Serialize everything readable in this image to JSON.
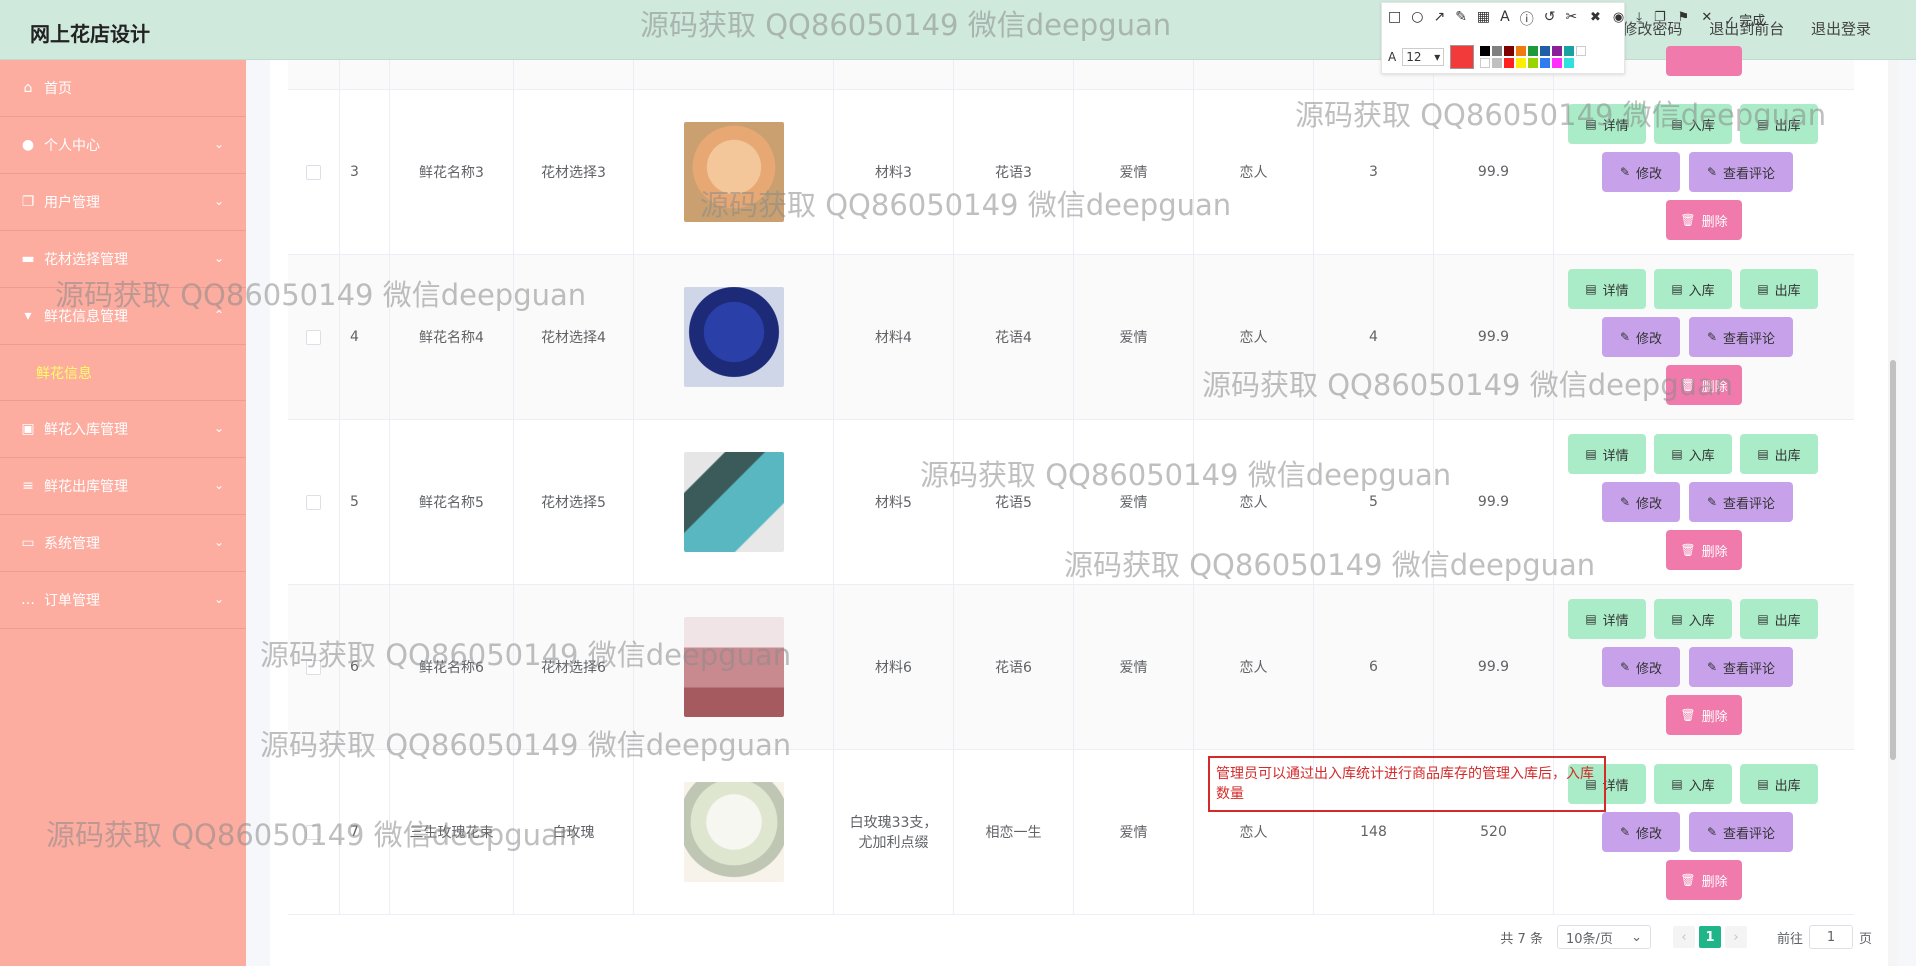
{
  "app": {
    "title": "网上花店设计",
    "header_links": [
      "修改密码",
      "退出到前台",
      "退出登录"
    ]
  },
  "sidebar": {
    "items": [
      {
        "label": "首页",
        "icon": "home-icon"
      },
      {
        "label": "个人中心",
        "icon": "user-icon"
      },
      {
        "label": "用户管理",
        "icon": "copy-icon"
      },
      {
        "label": "花材选择管理",
        "icon": "chat-icon"
      },
      {
        "label": "鲜花信息管理",
        "icon": "drink-icon"
      },
      {
        "label": "鲜花入库管理",
        "icon": "briefcase-icon"
      },
      {
        "label": "鲜花出库管理",
        "icon": "list-icon"
      },
      {
        "label": "系统管理",
        "icon": "monitor-icon"
      },
      {
        "label": "订单管理",
        "icon": "message-icon"
      }
    ],
    "submenu": {
      "label": "鲜花信息"
    }
  },
  "table": {
    "rows": [
      {
        "idx": "3",
        "name": "鲜花名称3",
        "material_choice": "花材选择3",
        "material": "材料3",
        "language": "花语3",
        "category": "爱情",
        "target": "恋人",
        "stock": "3",
        "price": "99.9"
      },
      {
        "idx": "4",
        "name": "鲜花名称4",
        "material_choice": "花材选择4",
        "material": "材料4",
        "language": "花语4",
        "category": "爱情",
        "target": "恋人",
        "stock": "4",
        "price": "99.9"
      },
      {
        "idx": "5",
        "name": "鲜花名称5",
        "material_choice": "花材选择5",
        "material": "材料5",
        "language": "花语5",
        "category": "爱情",
        "target": "恋人",
        "stock": "5",
        "price": "99.9"
      },
      {
        "idx": "6",
        "name": "鲜花名称6",
        "material_choice": "花材选择6",
        "material": "材料6",
        "language": "花语6",
        "category": "爱情",
        "target": "恋人",
        "stock": "6",
        "price": "99.9"
      },
      {
        "idx": "7",
        "name": "三生玫瑰花束",
        "material_choice": "白玫瑰",
        "material": "白玫瑰33支，尤加利点缀",
        "language": "相恋一生",
        "category": "爱情",
        "target": "恋人",
        "stock": "148",
        "price": "520"
      }
    ],
    "ops": {
      "detail": "详情",
      "in": "入库",
      "out": "出库",
      "edit": "修改",
      "review": "查看评论",
      "delete": "删除"
    }
  },
  "pager": {
    "total": "共 7 条",
    "page_size": "10条/页",
    "current_page": "1",
    "goto_label": "前往",
    "goto_value": "1",
    "page_unit": "页"
  },
  "note": {
    "text": "管理员可以通过出入库统计进行商品库存的管理入库后，入库数量"
  },
  "watermark": {
    "text": "源码获取 QQ86050149 微信deepguan"
  },
  "toolbar": {
    "font_size": "12",
    "done_label": "完成"
  },
  "colors": {
    "sidebar_bg": "#fdaca0",
    "header_bg": "#cfe9dc",
    "accent_green": "#1fb589",
    "submenu_text": "#ffff66"
  }
}
